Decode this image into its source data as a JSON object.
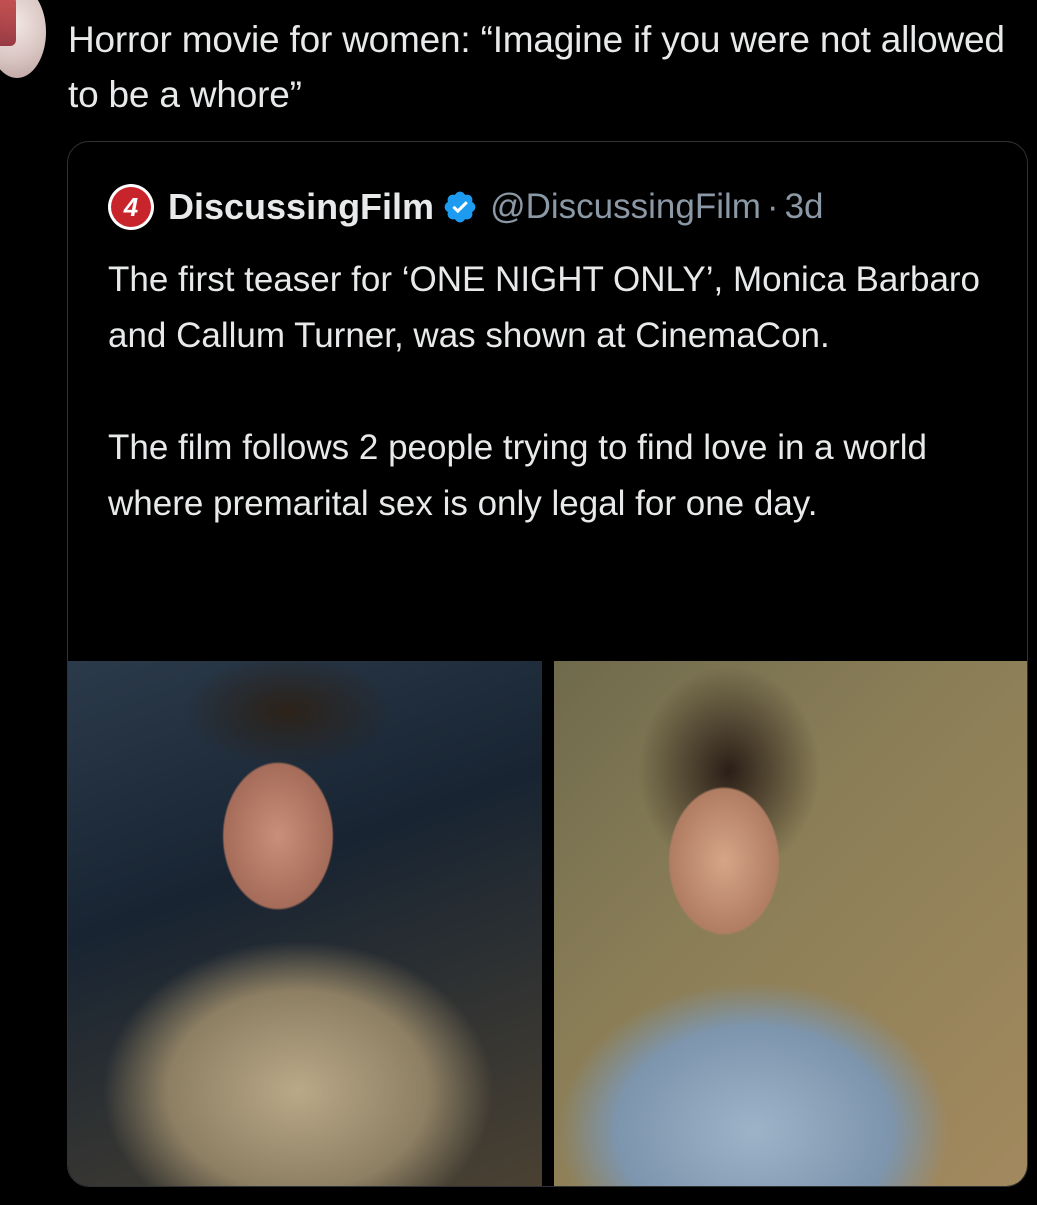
{
  "tweet": {
    "text": "Horror movie for women: “Imagine if you were not allowed to be a whore”"
  },
  "quote": {
    "author": {
      "name": "DiscussingFilm",
      "handle": "@DiscussingFilm",
      "separator": "·",
      "time": "3d",
      "avatar_logo": "4",
      "verified": true
    },
    "paragraphs": [
      "The first teaser for ‘ONE NIGHT ONLY’, Monica Barbaro and Callum Turner, was shown at CinemaCon.",
      "The film follows 2 people trying to find love in a world where premarital sex is only legal for one day."
    ],
    "media": [
      {
        "description_icon": "photo-man-shearling-jacket"
      },
      {
        "description_icon": "photo-woman-denim-shirt"
      }
    ]
  },
  "colors": {
    "background": "#000000",
    "text": "#e7e9ea",
    "secondary_text": "#8b98a5",
    "border": "#2f3336",
    "verified_badge": "#1d9bf0",
    "logo_red": "#c8242c"
  }
}
